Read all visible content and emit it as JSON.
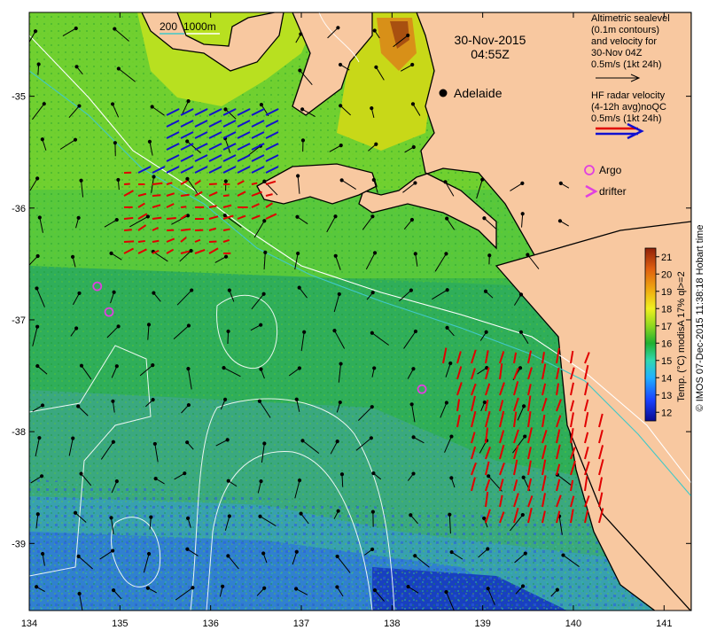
{
  "datetime": {
    "date": "30-Nov-2015",
    "time": "04:55Z"
  },
  "city": {
    "name": "Adelaide"
  },
  "depth_legend": {
    "label_200": "200",
    "label_1000": "1000m",
    "color_200": "#40c8c8",
    "color_1000": "#ffffff"
  },
  "legend": {
    "altimetry": [
      "Altimetric sealevel",
      "(0.1m contours)",
      "and velocity for",
      "30-Nov 04Z",
      "0.5m/s (1kt 24h)"
    ],
    "hf_radar": [
      "HF radar velocity",
      "(4-12h avg)noQC",
      "0.5m/s (1kt 24h)"
    ],
    "argo_label": "Argo",
    "drifter_label": "drifter",
    "argo_color": "#e040e0",
    "hf_colors": [
      "#ff0000",
      "#0000ff"
    ]
  },
  "colorbar": {
    "label": "Temp. (°C) modisA 17% ql>=2",
    "ticks": [
      "21",
      "20",
      "19",
      "18",
      "17",
      "16",
      "15",
      "14",
      "13",
      "12"
    ],
    "range": [
      11.5,
      21.5
    ]
  },
  "axes": {
    "x_ticks": [
      "134",
      "135",
      "136",
      "137",
      "138",
      "139",
      "140",
      "141"
    ],
    "y_ticks": [
      "-35",
      "-36",
      "-37",
      "-38",
      "-39"
    ],
    "lon_range": [
      134,
      141.3
    ],
    "lat_range": [
      -34.25,
      -39.6
    ]
  },
  "argo_floats": [
    [
      134.75,
      -36.7
    ],
    [
      134.88,
      -36.93
    ],
    [
      138.33,
      -37.62
    ]
  ],
  "credit": "© IMOS 07-Dec-2015 11:38:18 Hobart time"
}
